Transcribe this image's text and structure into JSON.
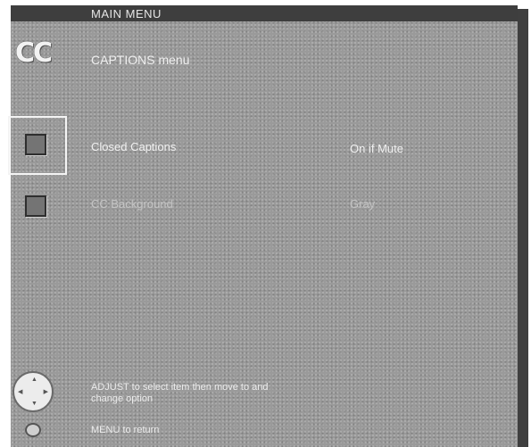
{
  "header": {
    "title": "MAIN MENU"
  },
  "menu": {
    "heading": "CAPTIONS menu",
    "cc_icon_text": "CC",
    "options": [
      {
        "label": "Closed Captions",
        "value": "On if Mute",
        "selected": true
      },
      {
        "label": "CC Background",
        "value": "Gray",
        "selected": false
      }
    ]
  },
  "footer": {
    "adjust_help": "ADJUST to select item then move to and change option",
    "menu_help": "MENU to return",
    "joystick_icon": "joystick-icon",
    "menu_button_icon": "menu-button-icon"
  },
  "colors": {
    "screen": "#9a9a9a",
    "header": "#3e3e3e",
    "text": "#f0f0f0",
    "dim_text": "#c4c4c4"
  }
}
